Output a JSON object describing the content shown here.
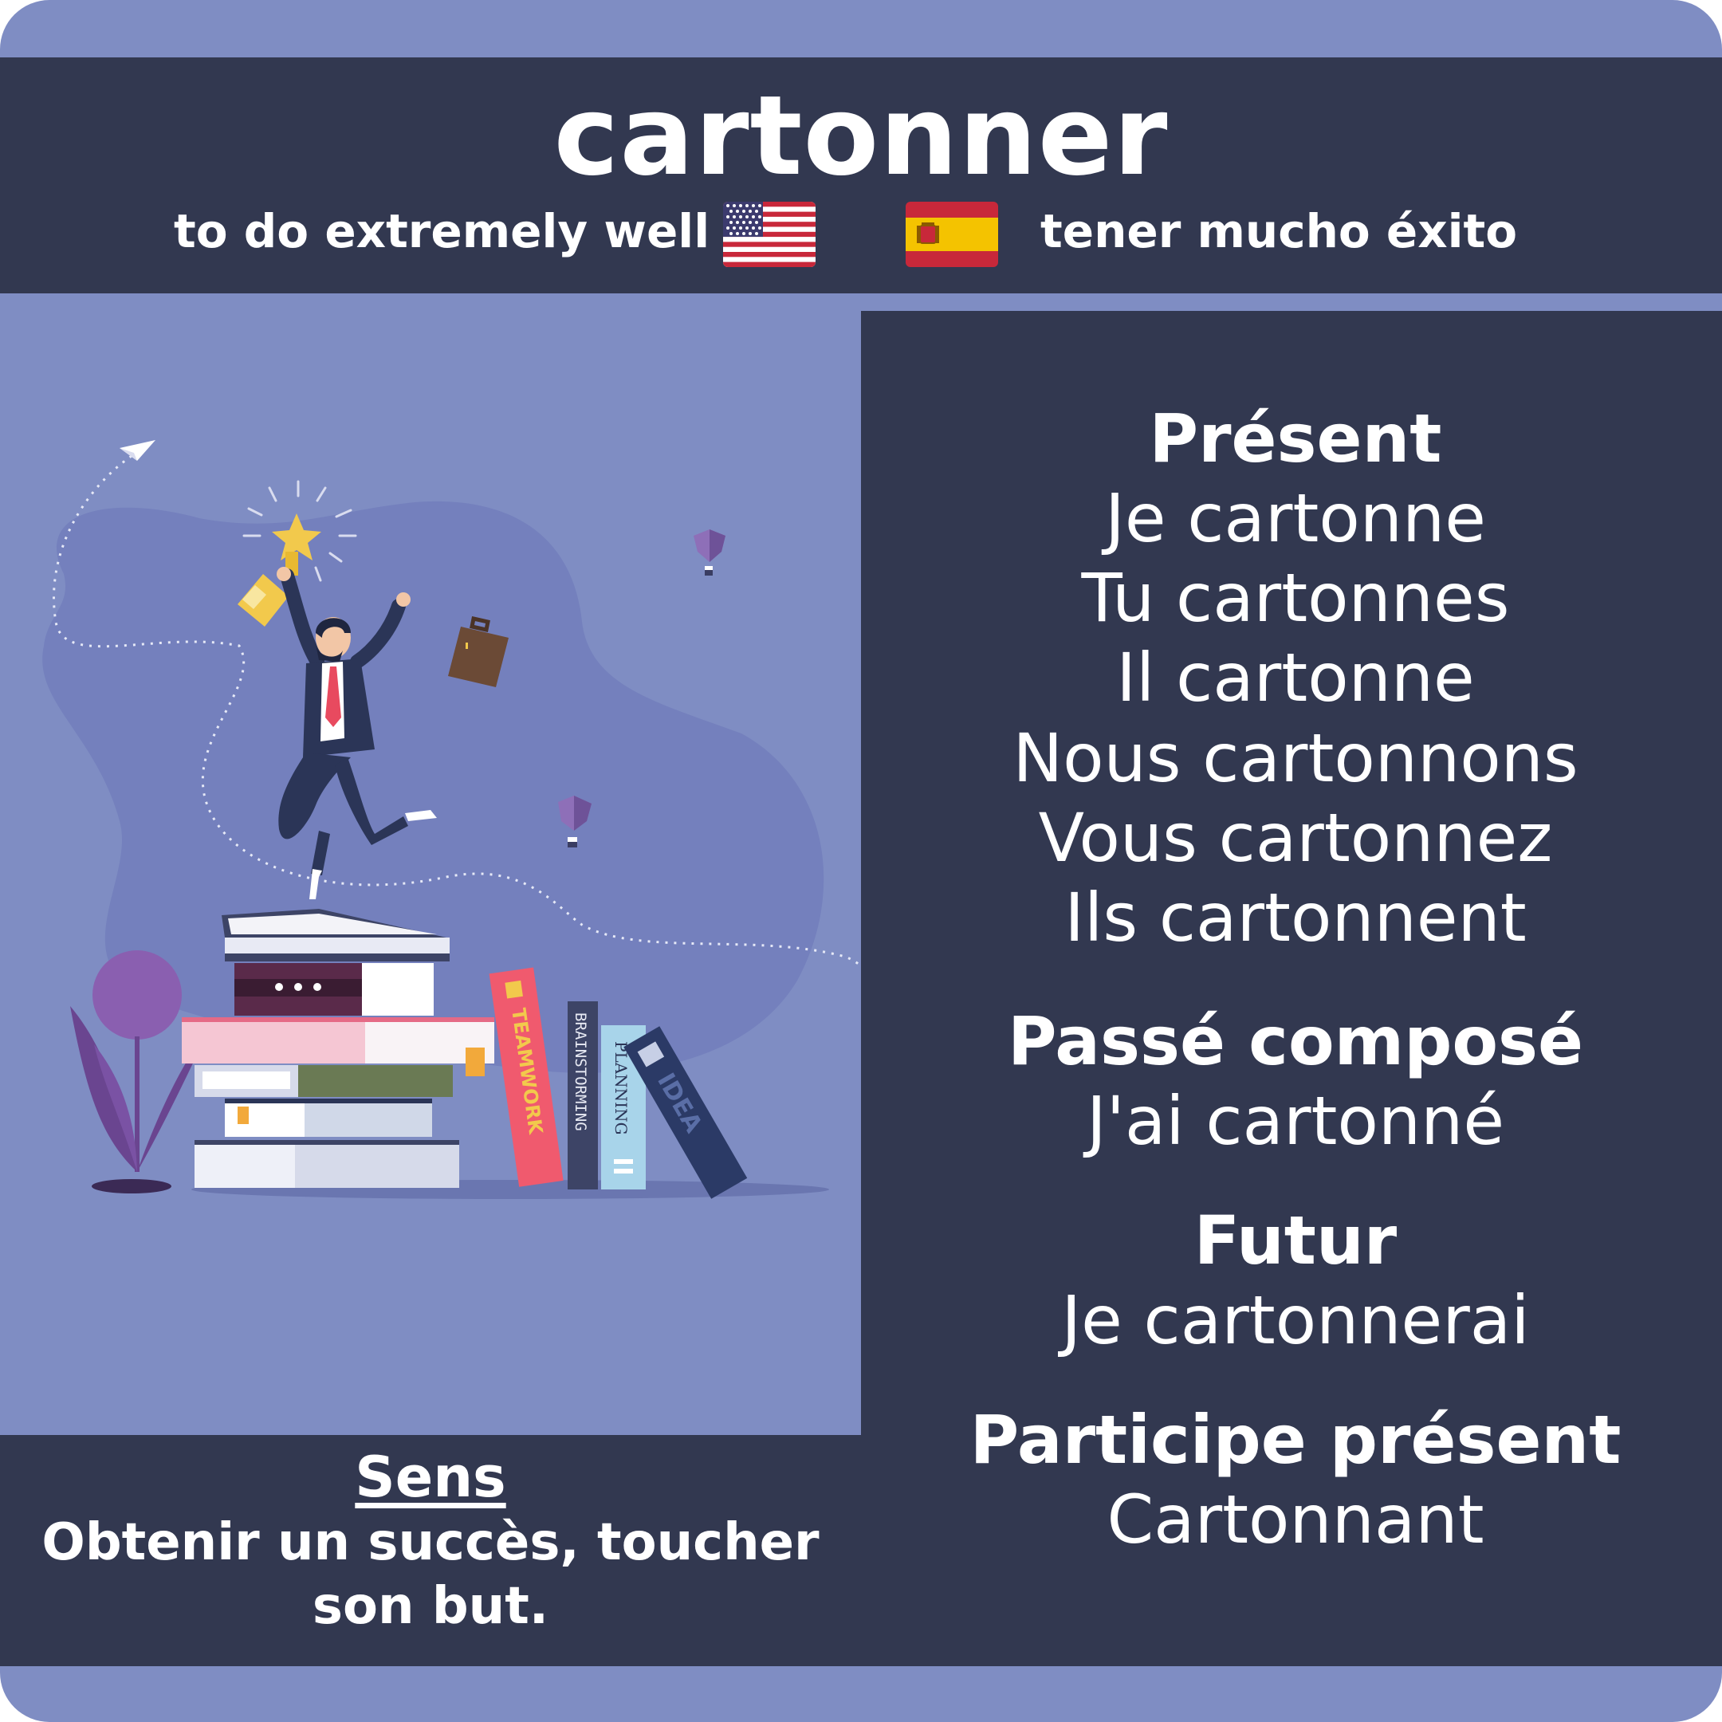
{
  "card": {
    "title": "cartonner",
    "english": "to do extremely well",
    "spanish": "tener mucho éxito",
    "flags": {
      "english": "us-flag-icon",
      "spanish": "spain-flag-icon"
    }
  },
  "conjugation": {
    "present": {
      "heading": "Présent",
      "forms": [
        "Je cartonne",
        "Tu cartonnes",
        "Il cartonne",
        "Nous cartonnons",
        "Vous cartonnez",
        "Ils cartonnent"
      ]
    },
    "passe_compose": {
      "heading": "Passé composé",
      "form": "J'ai cartonné"
    },
    "futur": {
      "heading": "Futur",
      "form": "Je cartonnerai"
    },
    "participe_present": {
      "heading": "Participe présent",
      "form": "Cartonnant"
    }
  },
  "meaning": {
    "label": "Sens",
    "text": "Obtenir un succès, toucher son but."
  },
  "illustration": {
    "book_spines": [
      "TEAMWORK",
      "BRAINSTORMING",
      "PLANNING",
      "IDEA"
    ]
  },
  "colors": {
    "background": "#7f8dc3",
    "panel": "#323850",
    "text": "#ffffff"
  }
}
